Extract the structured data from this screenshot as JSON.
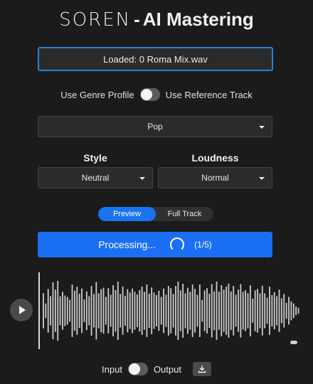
{
  "header": {
    "brand": "SOREN",
    "separator": "-",
    "product": "AI Mastering"
  },
  "file": {
    "loaded_text": "Loaded: 0 Roma Mix.wav"
  },
  "profile_toggle": {
    "left_label": "Use Genre Profile",
    "right_label": "Use Reference Track"
  },
  "genre": {
    "selected": "Pop"
  },
  "style": {
    "label": "Style",
    "selected": "Neutral"
  },
  "loudness": {
    "label": "Loudness",
    "selected": "Normal"
  },
  "preview_toggle": {
    "options": [
      "Preview",
      "Full Track"
    ],
    "active": "Preview"
  },
  "process": {
    "label": "Processing...",
    "count": "(1/5)"
  },
  "waveform": {
    "amplitudes": [
      0.48,
      0.2,
      0.6,
      0.4,
      0.78,
      0.58,
      0.82,
      0.4,
      0.52,
      0.42,
      0.38,
      0.3,
      0.72,
      0.55,
      0.66,
      0.47,
      0.61,
      0.31,
      0.53,
      0.4,
      0.68,
      0.46,
      0.79,
      0.48,
      0.59,
      0.63,
      0.38,
      0.62,
      0.44,
      0.7,
      0.57,
      0.8,
      0.46,
      0.66,
      0.41,
      0.59,
      0.5,
      0.61,
      0.52,
      0.45,
      0.57,
      0.66,
      0.52,
      0.72,
      0.47,
      0.64,
      0.5,
      0.43,
      0.55,
      0.38,
      0.61,
      0.44,
      0.68,
      0.62,
      0.46,
      0.68,
      0.8,
      0.56,
      0.74,
      0.48,
      0.63,
      0.52,
      0.72,
      0.6,
      0.44,
      0.72,
      0.3,
      0.56,
      0.62,
      0.47,
      0.73,
      0.53,
      0.8,
      0.52,
      0.7,
      0.58,
      0.66,
      0.74,
      0.53,
      0.68,
      0.44,
      0.58,
      0.73,
      0.52,
      0.56,
      0.48,
      0.7,
      0.33,
      0.56,
      0.6,
      0.48,
      0.68,
      0.48,
      0.36,
      0.66,
      0.43,
      0.51,
      0.4,
      0.58,
      0.34,
      0.46,
      0.22,
      0.38,
      0.26,
      0.2,
      0.12,
      0.08
    ]
  },
  "output_toggle": {
    "left_label": "Input",
    "right_label": "Output"
  },
  "colors": {
    "accent": "#1a6ff5",
    "background": "#1b1b1b",
    "wave": "#c8c8c8"
  }
}
